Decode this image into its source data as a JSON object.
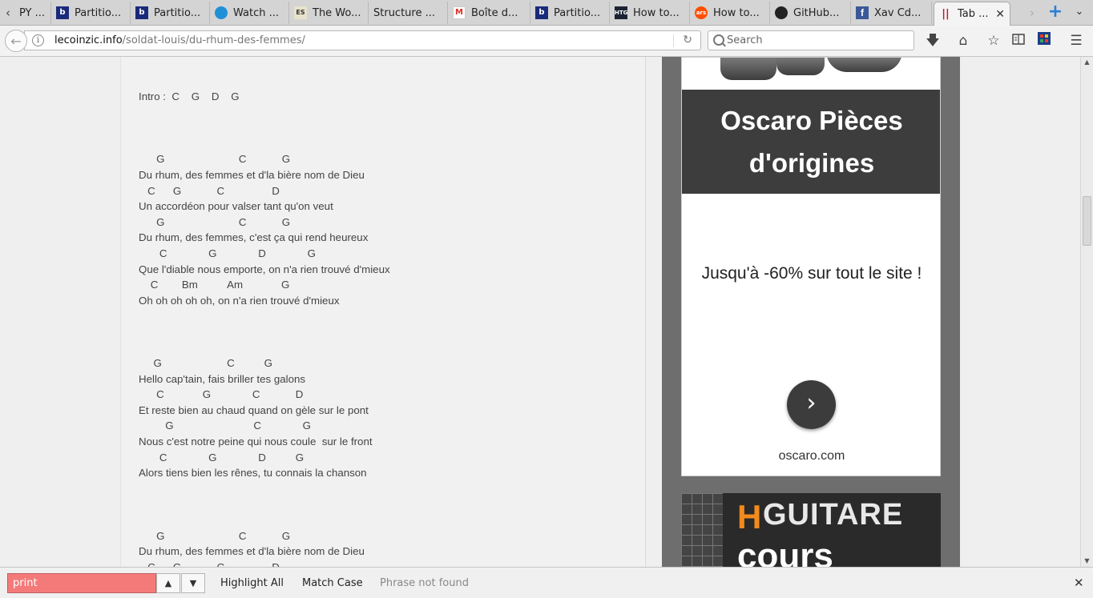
{
  "tabs": [
    {
      "label": "PY ...",
      "icon": "",
      "icon_name": "none"
    },
    {
      "label": "Partitio...",
      "icon": "b",
      "icon_name": "partition-site-icon"
    },
    {
      "label": "Partitio...",
      "icon": "b",
      "icon_name": "partition-site-icon"
    },
    {
      "label": "Watch ...",
      "icon": "",
      "icon_name": "watch-icon"
    },
    {
      "label": "The Wo...",
      "icon": "ES",
      "icon_name": "es-icon"
    },
    {
      "label": "Structure ...",
      "icon": "",
      "icon_name": "none"
    },
    {
      "label": "Boîte d...",
      "icon": "M",
      "icon_name": "gmail-icon"
    },
    {
      "label": "Partitio...",
      "icon": "b",
      "icon_name": "partition-site-icon"
    },
    {
      "label": "How to...",
      "icon": "HTG",
      "icon_name": "htg-icon"
    },
    {
      "label": "How to...",
      "icon": "ars",
      "icon_name": "ars-icon"
    },
    {
      "label": "GitHub...",
      "icon": "",
      "icon_name": "github-icon"
    },
    {
      "label": "Xav Cd...",
      "icon": "f",
      "icon_name": "facebook-icon"
    },
    {
      "label": "Tab ...",
      "icon": "||",
      "icon_name": "tab-site-icon",
      "active": true
    }
  ],
  "navbar": {
    "url_host": "lecoinzic.info",
    "url_path": "/soldat-louis/du-rhum-des-femmes/",
    "search_placeholder": "Search"
  },
  "lyrics": {
    "text": "Intro :  C    G    D    G\n\n\n\n      G                         C            G\nDu rhum, des femmes et d'la bière nom de Dieu\n   C      G            C                D\nUn accordéon pour valser tant qu'on veut\n      G                         C            G\nDu rhum, des femmes, c'est ça qui rend heureux\n       C              G              D              G\nQue l'diable nous emporte, on n'a rien trouvé d'mieux\n    C        Bm          Am             G\nOh oh oh oh oh, on n'a rien trouvé d'mieux\n\n\n\n     G                      C          G\nHello cap'tain, fais briller tes galons\n      C             G              C            D\nEt reste bien au chaud quand on gèle sur le pont\n         G                           C              G\nNous c'est notre peine qui nous coule  sur le front\n       C              G              D          G\nAlors tiens bien les rênes, tu connais la chanson\n\n\n\n      G                         C            G\nDu rhum, des femmes et d'la bière nom de Dieu\n   C      G            C                D"
  },
  "ad1": {
    "headline": "Oscaro Pièces d'origines",
    "body": "Jusqu'à -60% sur tout le site !",
    "cta_icon": "chevron-right-icon",
    "domain": "oscaro.com",
    "headline_bg": "#3d3d3d"
  },
  "ad2": {
    "h": "H",
    "title": "GUITARE",
    "subtitle": "cours",
    "accent": "#f28a1c"
  },
  "findbar": {
    "query": "print",
    "highlight_all": "Highlight All",
    "match_case": "Match Case",
    "status": "Phrase not found"
  }
}
